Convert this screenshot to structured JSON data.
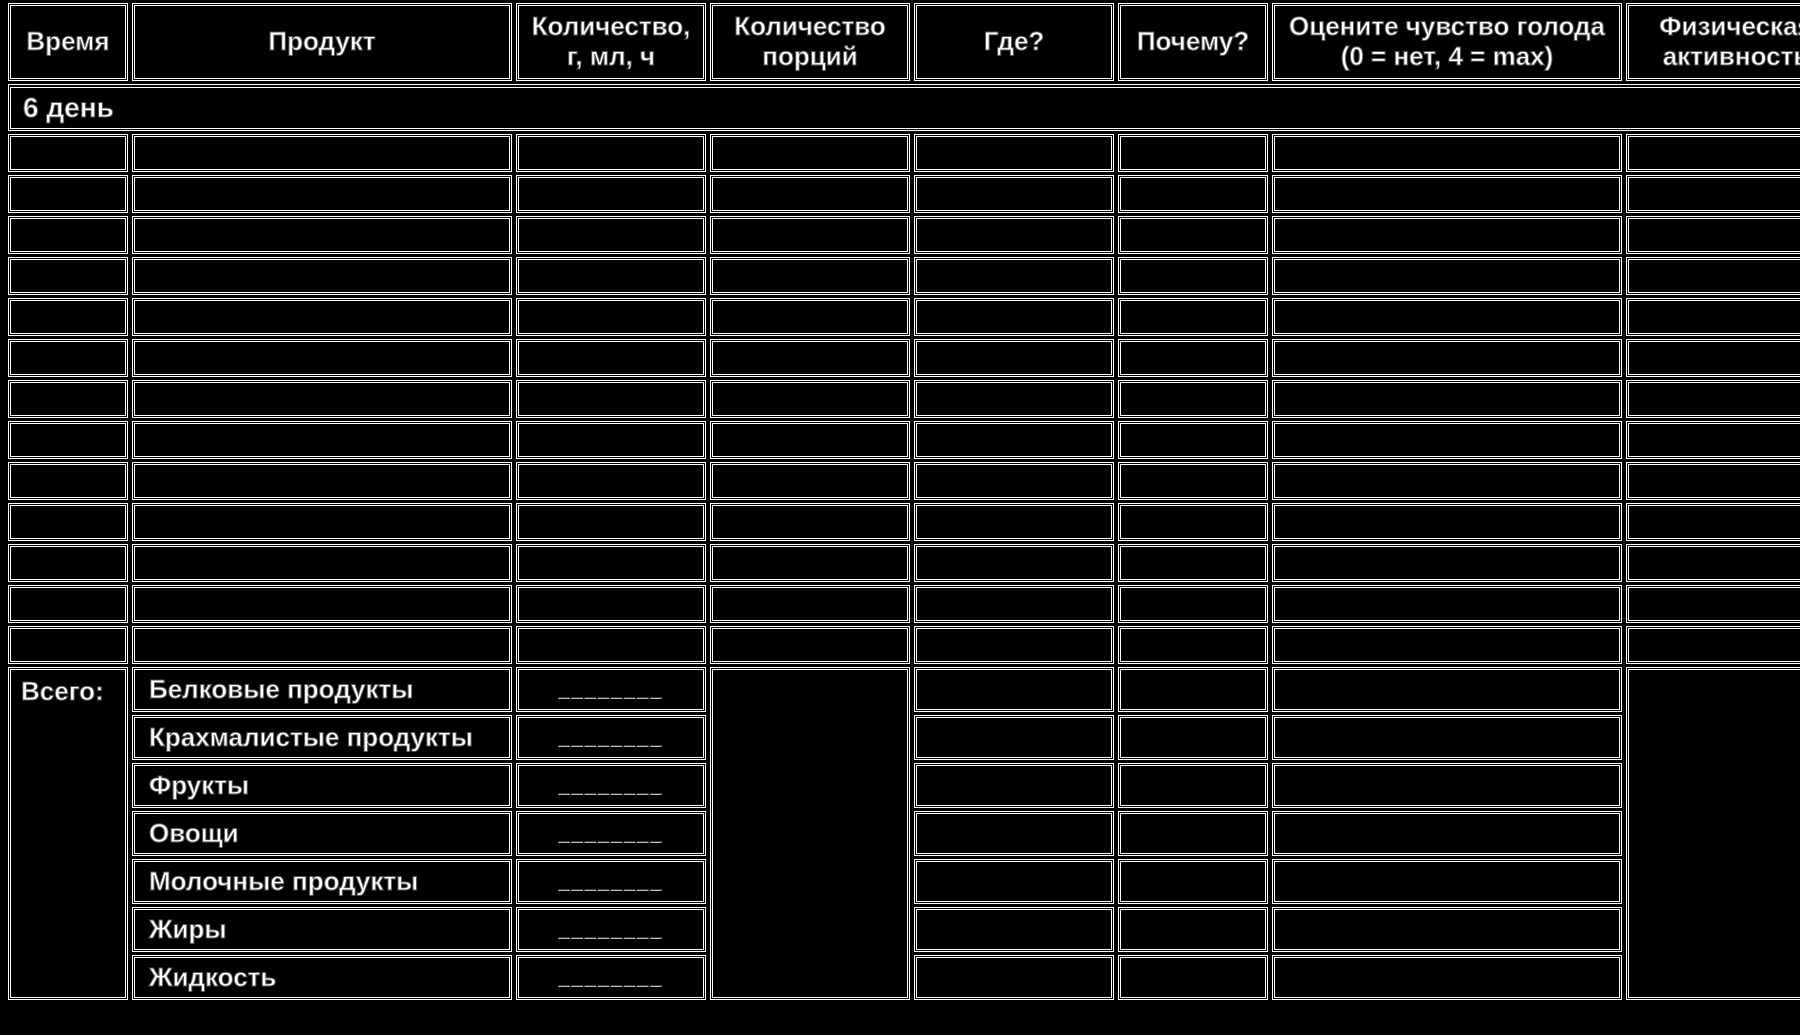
{
  "header": {
    "time": "Время",
    "product": "Продукт",
    "quantity": "Количество,\nг, мл, ч",
    "portions": "Количество\nпорций",
    "where": "Где?",
    "why": "Почему?",
    "hunger": "Оцените чувство голода\n(0 = нет, 4 = max)",
    "activity": "Физическая\nактивность"
  },
  "day_label": "6 день",
  "entry_rows": 13,
  "totals": {
    "label": "Всего:",
    "blank_placeholder": "________",
    "categories": [
      "Белковые продукты",
      "Крахмалистые продукты",
      "Фрукты",
      "Овощи",
      "Молочные продукты",
      "Жиры",
      "Жидкость"
    ]
  }
}
